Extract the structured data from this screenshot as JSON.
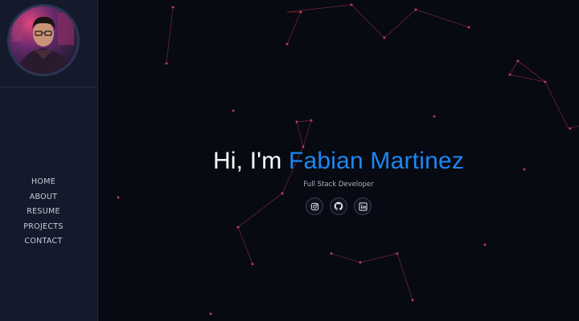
{
  "profile": {
    "avatar_alt": "Fabian Martinez profile photo"
  },
  "nav": {
    "items": [
      "HOME",
      "ABOUT",
      "RESUME",
      "PROJECTS",
      "CONTACT"
    ]
  },
  "hero": {
    "greeting": "Hi, I'm",
    "name": "Fabian Martinez",
    "subtitle": "Full Stack Developer"
  },
  "socials": [
    {
      "name": "instagram-icon"
    },
    {
      "name": "github-icon"
    },
    {
      "name": "linkedin-icon"
    }
  ],
  "colors": {
    "background": "#070a12",
    "sidebar": "#141a2b",
    "accent": "#1d87f2",
    "particle": "#c0395a"
  }
}
